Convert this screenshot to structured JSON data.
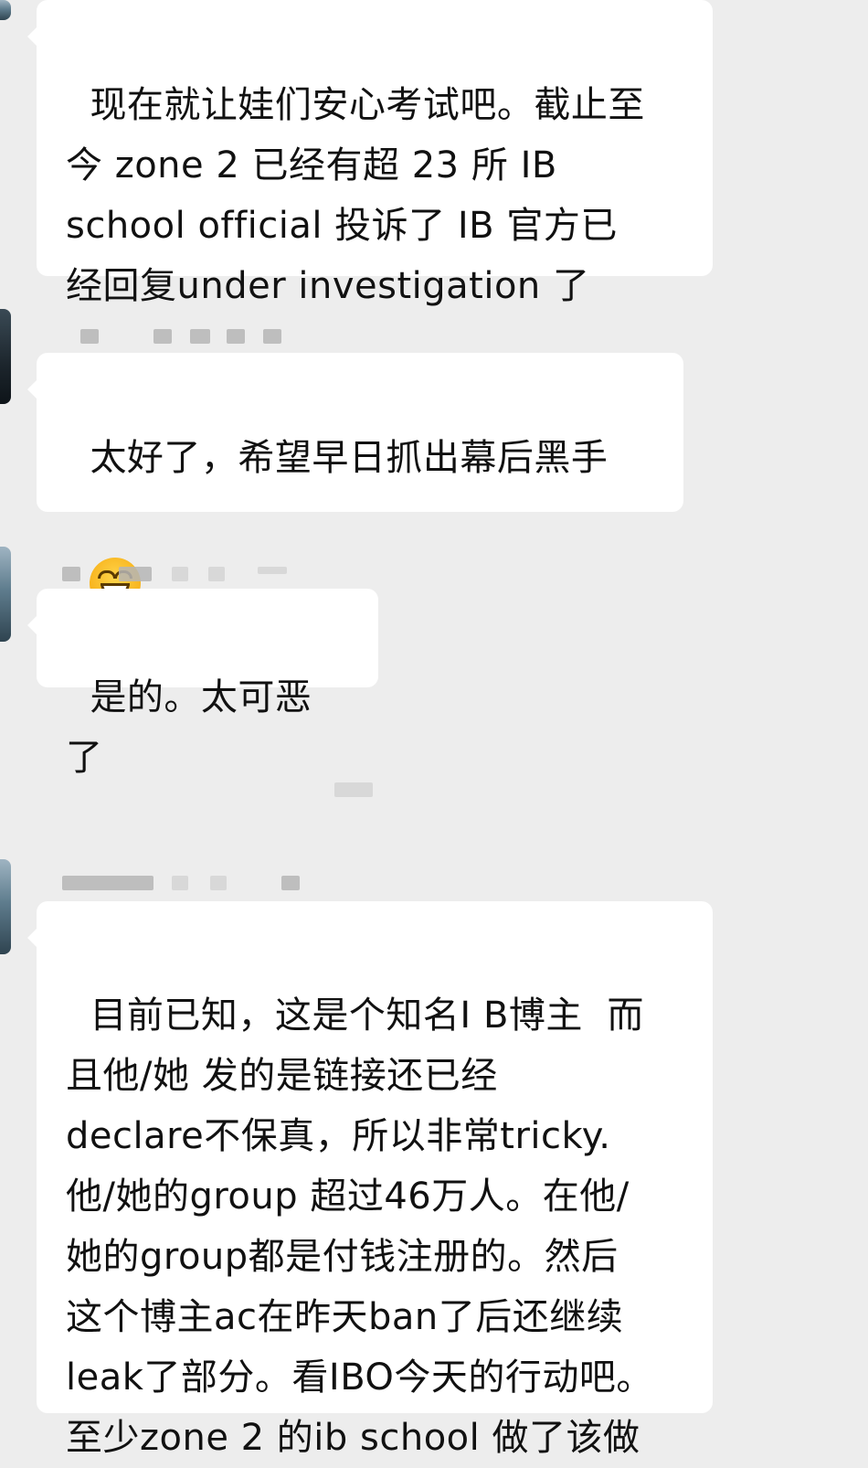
{
  "messages": [
    {
      "text": "现在就让娃们安心考试吧。截止至\n今 zone 2 已经有超 23 所 IB\nschool official 投诉了 IB 官方已\n经回复under investigation 了"
    },
    {
      "text": "太好了，希望早日抓出幕后黑手",
      "emoji": "grinning-smiling-eyes-emoji"
    },
    {
      "text": "是的。太可恶了"
    },
    {
      "text": "目前已知，这是个知名I B博主  而\n且他/她 发的是链接还已经\ndeclare不保真，所以非常tricky.\n他/她的group 超过46万人。在他/\n她的group都是付钱注册的。然后\n这个博主ac在昨天ban了后还继续\nleak了部分。看IBO今天的行动吧。\n至少zone 2 的ib school 做了该做"
    }
  ]
}
